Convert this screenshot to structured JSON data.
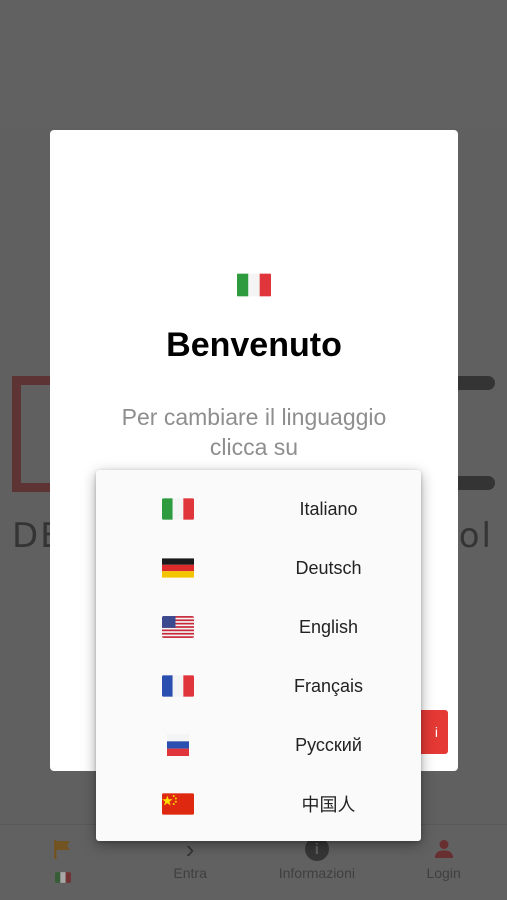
{
  "background": {
    "logo_text_left": "DE",
    "logo_text_right": "ol"
  },
  "dialog": {
    "flag_icon": "italy-flag-icon",
    "title": "Benvenuto",
    "message": "Per cambiare il linguaggio clicca su",
    "confirm_button_label": "i",
    "accent_color": "#e53935"
  },
  "language_menu": {
    "items": [
      {
        "label": "Italiano",
        "icon": "italy-flag-icon"
      },
      {
        "label": "Deutsch",
        "icon": "germany-flag-icon"
      },
      {
        "label": "English",
        "icon": "usa-flag-icon"
      },
      {
        "label": "Français",
        "icon": "france-flag-icon"
      },
      {
        "label": "Русский",
        "icon": "russia-flag-icon"
      },
      {
        "label": "中国人",
        "icon": "china-flag-icon"
      }
    ]
  },
  "tabbar": {
    "tabs": [
      {
        "label": "",
        "icon": "flag-icon"
      },
      {
        "label": "Entra",
        "icon": "chevron-right-icon"
      },
      {
        "label": "Informazioni",
        "icon": "info-icon"
      },
      {
        "label": "Login",
        "icon": "user-icon"
      }
    ],
    "active_color": "#c8860a",
    "login_color": "#c62828"
  }
}
